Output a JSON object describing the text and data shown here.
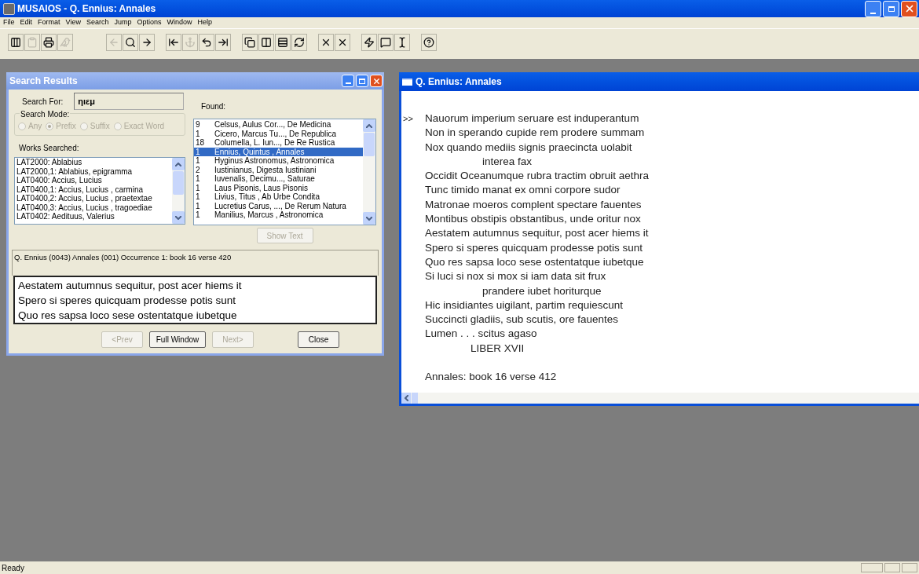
{
  "window": {
    "title": "MUSAIOS - Q. Ennius: Annales"
  },
  "menu": [
    "File",
    "Edit",
    "Format",
    "View",
    "Search",
    "Jump",
    "Options",
    "Window",
    "Help"
  ],
  "toolbar": [
    [
      {
        "disabled": false
      },
      {
        "disabled": true
      },
      {
        "disabled": false
      },
      {
        "disabled": true
      }
    ],
    [
      {
        "disabled": true
      },
      {
        "disabled": false
      },
      {
        "disabled": false
      }
    ],
    [
      {
        "disabled": false
      },
      {
        "disabled": true
      },
      {
        "disabled": false
      },
      {
        "disabled": false
      }
    ],
    [
      {
        "disabled": false
      },
      {
        "disabled": false
      },
      {
        "disabled": false
      },
      {
        "disabled": false
      }
    ],
    [
      {
        "disabled": false
      },
      {
        "disabled": false
      }
    ],
    [
      {
        "disabled": false
      },
      {
        "disabled": false
      },
      {
        "disabled": false
      }
    ],
    [
      {
        "disabled": false
      }
    ]
  ],
  "search_results": {
    "title": "Search Results",
    "search_for_label": "Search For:",
    "search_for_value": "ηιεμ",
    "search_mode_label": "Search Mode:",
    "modes": [
      {
        "label": "Any",
        "selected": false,
        "disabled": true
      },
      {
        "label": "Prefix",
        "selected": true,
        "disabled": true
      },
      {
        "label": "Suffix",
        "selected": false,
        "disabled": true
      },
      {
        "label": "Exact Word",
        "selected": false,
        "disabled": true
      }
    ],
    "works_label": "Works Searched:",
    "works": [
      "LAT2000:  Ablabius",
      "LAT2000,1: Ablabius, epigramma",
      "LAT0400:  Accius, Lucius",
      "LAT0400,1: Accius, Lucius , carmina",
      "LAT0400,2: Accius, Lucius , praetextae",
      "LAT0400,3: Accius, Lucius , tragoediae",
      "LAT0402:  Aedituus, Valerius"
    ],
    "found_label": "Found:",
    "found": [
      {
        "count": "9",
        "work": "Celsus, Aulus Cor..., De Medicina",
        "selected": false
      },
      {
        "count": "1",
        "work": "Cicero, Marcus Tu..., De Republica",
        "selected": false
      },
      {
        "count": "18",
        "work": "Columella, L. Iun..., De Re Rustica",
        "selected": false
      },
      {
        "count": "1",
        "work": "Ennius, Quintus , Annales",
        "selected": true
      },
      {
        "count": "1",
        "work": "Hyginus Astronomus, Astronomica",
        "selected": false
      },
      {
        "count": "2",
        "work": "Iustinianus, Digesta Iustiniani",
        "selected": false
      },
      {
        "count": "1",
        "work": "Iuvenalis, Decimu..., Saturae",
        "selected": false
      },
      {
        "count": "1",
        "work": "Laus Pisonis, Laus Pisonis",
        "selected": false
      },
      {
        "count": "1",
        "work": "Livius, Titus , Ab Urbe Condita",
        "selected": false
      },
      {
        "count": "1",
        "work": "Lucretius Carus, ..., De Rerum Natura",
        "selected": false
      },
      {
        "count": "1",
        "work": "Manilius, Marcus , Astronomica",
        "selected": false
      }
    ],
    "show_text": {
      "label": "Show Text",
      "disabled": true
    },
    "occurrence": "Q. Ennius (0043) Annales  (001) Occurrence 1: book 16 verse 420",
    "excerpt": [
      "Aestatem autumnus sequitur, post acer hiems it",
      "Spero si speres quicquam prodesse potis sunt",
      "Quo res sapsa loco sese ostentatque iubetque"
    ],
    "buttons": [
      {
        "label": "<Prev",
        "disabled": true
      },
      {
        "label": "Full Window",
        "disabled": false
      },
      {
        "label": "Next>",
        "disabled": true
      },
      {
        "label": "Close",
        "disabled": false
      }
    ]
  },
  "text_window": {
    "title": "Q. Ennius: Annales",
    "lines": [
      {
        "kind": "verse",
        "marker": ">>",
        "text": "Nauorum imperium seruare est induperantum"
      },
      {
        "kind": "verse",
        "text": "Non in sperando cupide rem prodere summam"
      },
      {
        "kind": "verse",
        "text": "Nox quando mediis signis praecincta uolabit"
      },
      {
        "kind": "continuation",
        "text": "interea fax"
      },
      {
        "kind": "verse",
        "text": "Occidit Oceanumque rubra tractim obruit aethra"
      },
      {
        "kind": "verse",
        "text": "Tunc timido manat ex omni corpore sudor"
      },
      {
        "kind": "verse",
        "text": "Matronae moeros complent spectare fauentes"
      },
      {
        "kind": "verse",
        "text": "Montibus obstipis obstantibus, unde oritur nox"
      },
      {
        "kind": "verse",
        "text": "Aestatem autumnus sequitur, post acer hiems it"
      },
      {
        "kind": "verse",
        "text": "Spero si speres quicquam prodesse potis sunt"
      },
      {
        "kind": "verse",
        "text": "Quo res sapsa loco sese ostentatque iubetque"
      },
      {
        "kind": "verse",
        "text": "Si luci si nox si mox si iam data sit frux"
      },
      {
        "kind": "continuation",
        "text": "prandere iubet horiturque"
      },
      {
        "kind": "verse",
        "text": "Hic insidiantes uigilant, partim requiescunt"
      },
      {
        "kind": "verse",
        "text": "Succincti gladiis, sub scutis, ore fauentes"
      },
      {
        "kind": "verse",
        "text": "Lumen . . . scitus agaso"
      },
      {
        "kind": "heading",
        "text": "LIBER XVII"
      },
      {
        "kind": "blank"
      },
      {
        "kind": "verse",
        "text": "Annales:  book 16 verse 412"
      }
    ]
  },
  "status_bar": {
    "text": "Ready"
  }
}
